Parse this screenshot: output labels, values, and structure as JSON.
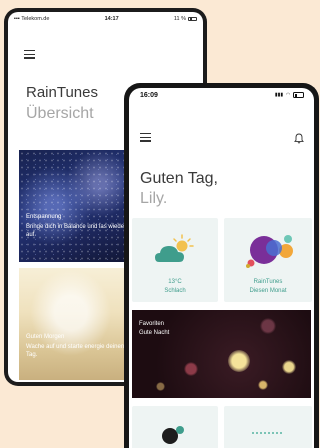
{
  "back_phone": {
    "status": {
      "carrier": "Telekom.de",
      "time": "14:17",
      "battery": "11 %"
    },
    "brand": "RainTunes",
    "subtitle": "Übersicht",
    "cards": [
      {
        "title": "Entspannung",
        "desc": "Bringe dich in Balance und las wieder auf."
      },
      {
        "title": "Guten Morgen",
        "desc": "Wache auf und starte energie deinen Tag."
      }
    ]
  },
  "front_phone": {
    "status": {
      "time": "16:09"
    },
    "greeting": "Guten Tag,",
    "name": "Lily.",
    "tiles": [
      {
        "line1": "13°C",
        "line2": "Schlach"
      },
      {
        "line1": "RainTunes",
        "line2": "Diesen Monat"
      }
    ],
    "featured": {
      "title": "Favoriten",
      "subtitle": "Gute Nacht"
    }
  },
  "colors": {
    "background": "#fbe9d4",
    "accent": "#3f9d8c",
    "tile_bg": "#eef4f3"
  },
  "icons": {
    "menu": "hamburger-icon",
    "notifications": "bell-icon",
    "weather": "partly-cloudy-icon",
    "stats": "circles-icon"
  }
}
